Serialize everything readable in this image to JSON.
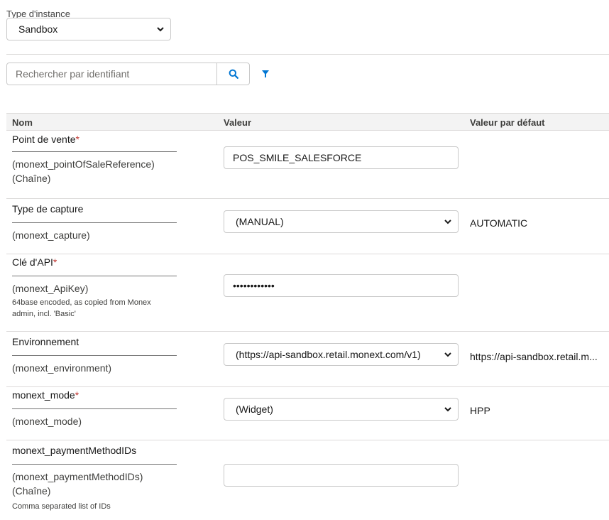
{
  "instance": {
    "label": "Type d'instance",
    "selected": "Sandbox"
  },
  "search": {
    "placeholder": "Rechercher par identifiant",
    "button_icon": "search-icon",
    "filter_icon": "filter-icon"
  },
  "table": {
    "headers": {
      "name": "Nom",
      "value": "Valeur",
      "default": "Valeur par défaut"
    },
    "rows": [
      {
        "label": "Point de vente",
        "required": "*",
        "key": "(monext_pointOfSaleReference)",
        "type": "(Chaîne)",
        "value": "POS_SMILE_SALESFORCE",
        "control": "text"
      },
      {
        "label": "Type de capture",
        "key": "(monext_capture)",
        "value": "(MANUAL)",
        "control": "select",
        "default": "AUTOMATIC"
      },
      {
        "label": "Clé d'API",
        "required": "*",
        "key": "(monext_ApiKey)",
        "help": "64base encoded, as copied from Monex admin, incl. 'Basic'",
        "value": "••••••••••••",
        "control": "password"
      },
      {
        "label": "Environnement",
        "key": "(monext_environment)",
        "value": "(https://api-sandbox.retail.monext.com/v1)",
        "control": "select",
        "default": "https://api-sandbox.retail.m..."
      },
      {
        "label": "monext_mode",
        "required": "*",
        "key": "(monext_mode)",
        "value": "(Widget)",
        "control": "select",
        "default": "HPP"
      },
      {
        "label": "monext_paymentMethodIDs",
        "key": "(monext_paymentMethodIDs)",
        "type": "(Chaîne)",
        "help": "Comma separated list of IDs",
        "value": "",
        "control": "text"
      }
    ]
  },
  "colors": {
    "accent": "#0176d3",
    "required": "#c23934",
    "border": "#c9c9c9",
    "divider": "#dddbda",
    "header_bg": "#f3f3f3"
  }
}
